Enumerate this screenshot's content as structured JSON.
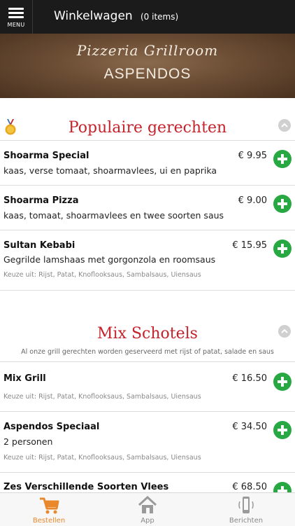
{
  "topbar": {
    "menu_label": "MENU",
    "title": "Winkelwagen",
    "count": "(0 items)"
  },
  "banner": {
    "script": "Pizzeria Grillroom",
    "name": "ASPENDOS"
  },
  "sections": [
    {
      "title": "Populaire gerechten",
      "subtitle": "",
      "items": [
        {
          "name": "Shoarma Special",
          "price": "€ 9.95",
          "desc": "kaas, verse tomaat, shoarmavlees, ui en paprika",
          "choice": ""
        },
        {
          "name": "Shoarma Pizza",
          "price": "€ 9.00",
          "desc": "kaas, tomaat, shoarmavlees en twee soorten saus",
          "choice": ""
        },
        {
          "name": "Sultan Kebabi",
          "price": "€ 15.95",
          "desc": "Gegrilde lamshaas met gorgonzola en roomsaus",
          "choice": "Keuze uit: Rijst, Patat, Knoflooksaus, Sambalsaus, Uiensaus"
        }
      ]
    },
    {
      "title": "Mix Schotels",
      "subtitle": "Al onze grill gerechten worden geserveerd met rijst of patat, salade en saus",
      "items": [
        {
          "name": "Mix Grill",
          "price": "€ 16.50",
          "desc": "",
          "choice": "Keuze uit: Rijst, Patat, Knoflooksaus, Sambalsaus, Uiensaus"
        },
        {
          "name": "Aspendos Speciaal",
          "price": "€ 34.50",
          "desc": "2 personen",
          "choice": "Keuze uit: Rijst, Patat, Knoflooksaus, Sambalsaus, Uiensaus"
        },
        {
          "name": "Zes Verschillende Soorten Vlees",
          "price": "€ 68.50",
          "desc": "",
          "choice": ""
        }
      ]
    }
  ],
  "tabs": [
    {
      "label": "Bestellen",
      "icon": "cart-icon",
      "active": true
    },
    {
      "label": "App",
      "icon": "home-icon",
      "active": false
    },
    {
      "label": "Berichten",
      "icon": "phone-icon",
      "active": false
    }
  ],
  "colors": {
    "accent_red": "#c6222b",
    "add_green": "#27a843",
    "active_tab": "#e8882a",
    "topbar": "#1b1b1b"
  }
}
